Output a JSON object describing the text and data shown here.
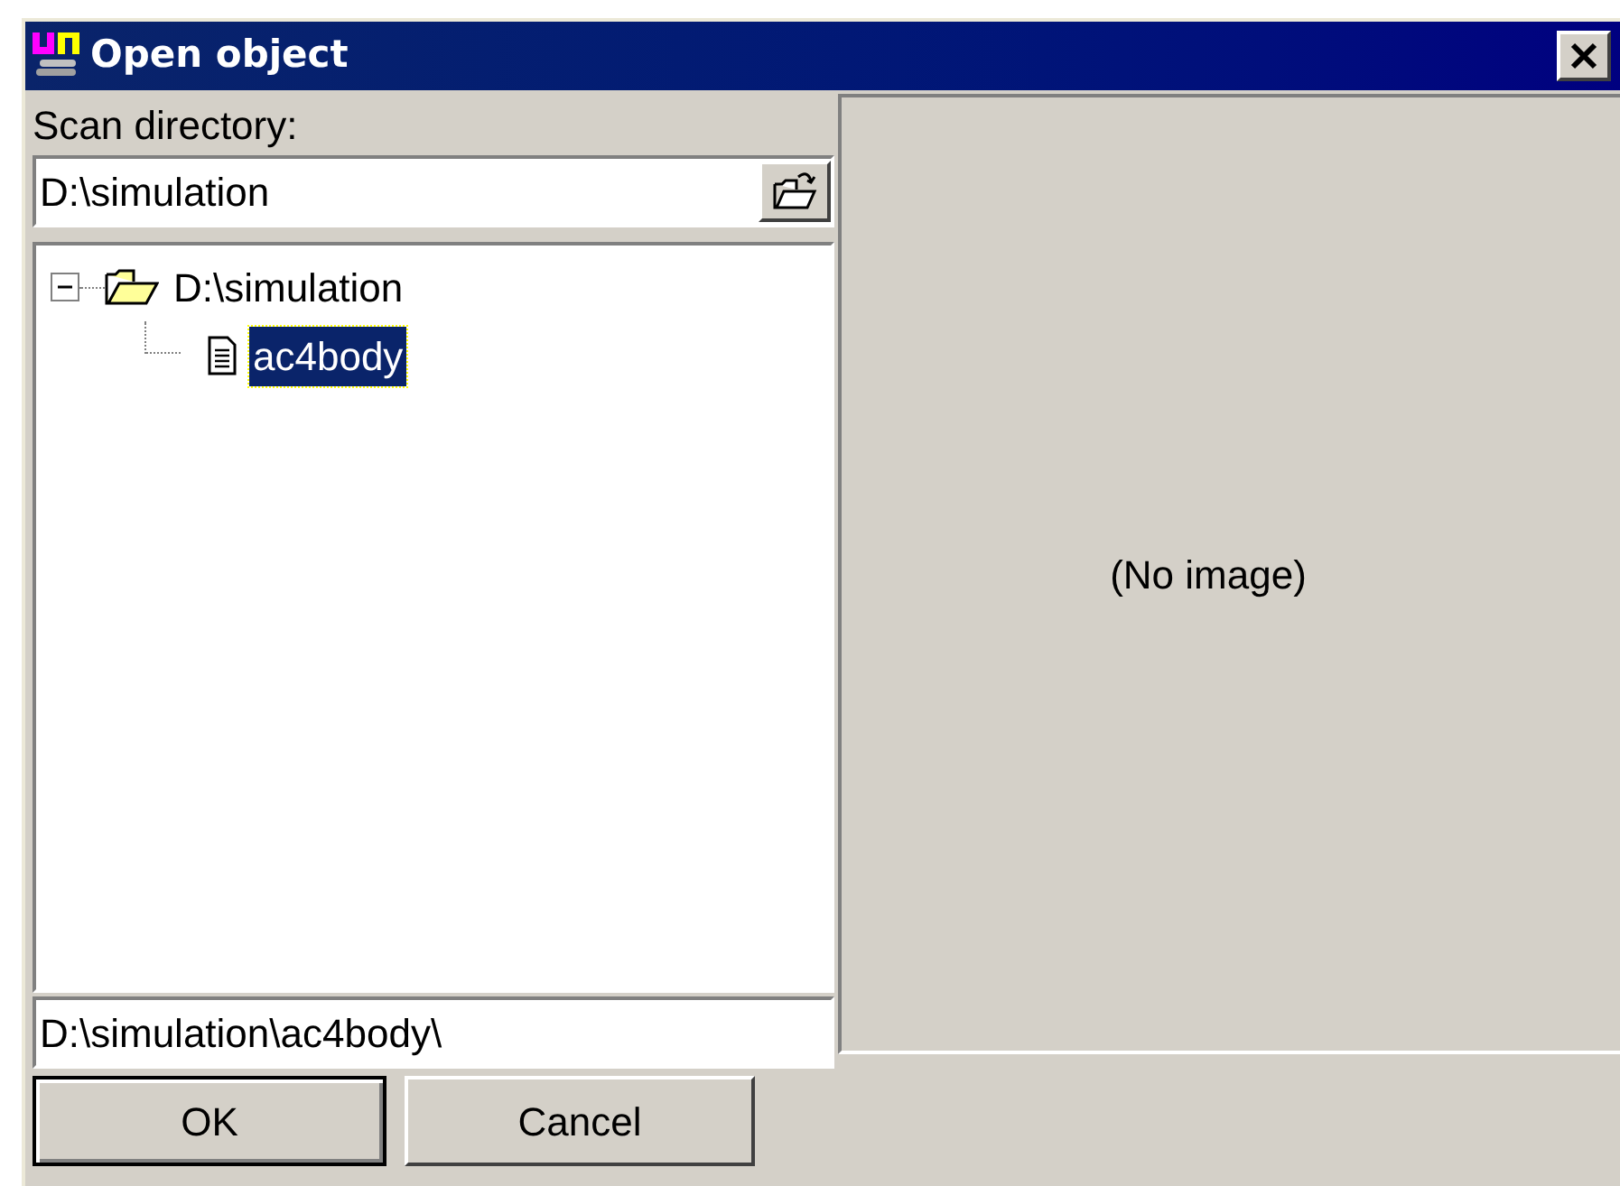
{
  "window": {
    "title": "Open object"
  },
  "scan_label": "Scan directory:",
  "scan_field": {
    "value": "D:\\simulation"
  },
  "tree": [
    {
      "label": "D:\\simulation",
      "kind": "folder",
      "expanded": true,
      "selected": false,
      "children": [
        {
          "label": "ac4body",
          "kind": "file",
          "selected": true
        }
      ]
    }
  ],
  "path_field": {
    "value": "D:\\simulation\\ac4body\\"
  },
  "preview": {
    "text": "(No image)"
  },
  "buttons": [
    {
      "label": "OK",
      "default": true
    },
    {
      "label": "Cancel",
      "default": false
    }
  ]
}
